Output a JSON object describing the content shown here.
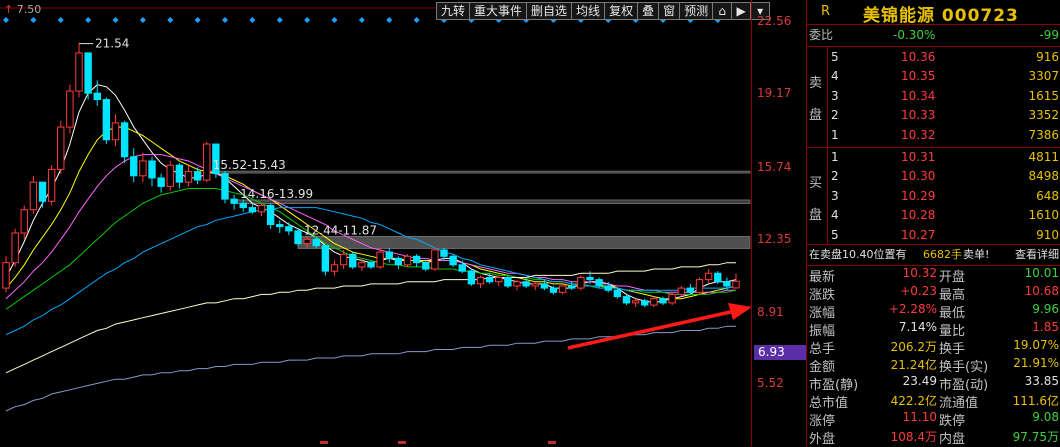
{
  "top_left_label": "7.50",
  "toolbar": [
    "九转",
    "重大事件",
    "删自选",
    "均线",
    "复权",
    "叠",
    "窗",
    "预测"
  ],
  "y_axis_ticks": [
    "22.56",
    "19.17",
    "15.74",
    "12.35",
    "8.91",
    "5.52"
  ],
  "y_axis_current": "6.93",
  "peak_label": "21.54",
  "gap_labels": [
    "15.52-15.43",
    "14.16-13.99",
    "12.44-11.87"
  ],
  "header": {
    "flag": "R",
    "title": "美锦能源 000723"
  },
  "weibi": {
    "label": "委比",
    "pct": "-0.30%",
    "diff": "-99"
  },
  "sell": {
    "label_chars": [
      "卖",
      "盘"
    ],
    "levels": [
      {
        "lvl": "5",
        "price": "10.36",
        "vol": "916"
      },
      {
        "lvl": "4",
        "price": "10.35",
        "vol": "3307"
      },
      {
        "lvl": "3",
        "price": "10.34",
        "vol": "1615"
      },
      {
        "lvl": "2",
        "price": "10.33",
        "vol": "3352"
      },
      {
        "lvl": "1",
        "price": "10.32",
        "vol": "7386"
      }
    ]
  },
  "buy": {
    "label_chars": [
      "买",
      "盘"
    ],
    "levels": [
      {
        "lvl": "1",
        "price": "10.31",
        "vol": "4811"
      },
      {
        "lvl": "2",
        "price": "10.30",
        "vol": "8498"
      },
      {
        "lvl": "3",
        "price": "10.29",
        "vol": "648"
      },
      {
        "lvl": "4",
        "price": "10.28",
        "vol": "1610"
      },
      {
        "lvl": "5",
        "price": "10.27",
        "vol": "910"
      }
    ]
  },
  "notice": {
    "prefix": "在卖盘10.40位置有",
    "qty": "6682手",
    "suffix": "卖单!",
    "link": "查看详细"
  },
  "stats": [
    {
      "l1": "最新",
      "v1": "10.32",
      "c1": "red",
      "l2": "开盘",
      "v2": "10.01",
      "c2": "green"
    },
    {
      "l1": "涨跌",
      "v1": "+0.23",
      "c1": "red",
      "l2": "最高",
      "v2": "10.68",
      "c2": "red"
    },
    {
      "l1": "涨幅",
      "v1": "+2.28%",
      "c1": "red",
      "l2": "最低",
      "v2": "9.96",
      "c2": "green"
    },
    {
      "l1": "振幅",
      "v1": "7.14%",
      "c1": "white",
      "l2": "量比",
      "v2": "1.85",
      "c2": "red"
    },
    {
      "l1": "总手",
      "v1": "206.2万",
      "c1": "yellow",
      "l2": "换手",
      "v2": "19.07%",
      "c2": "yellow"
    },
    {
      "l1": "金额",
      "v1": "21.24亿",
      "c1": "yellow",
      "l2": "换手(实)",
      "v2": "21.91%",
      "c2": "yellow"
    },
    {
      "l1": "市盈(静)",
      "v1": "23.49",
      "c1": "white",
      "l2": "市盈(动)",
      "v2": "33.85",
      "c2": "white"
    },
    {
      "l1": "总市值",
      "v1": "422.2亿",
      "c1": "yellow",
      "l2": "流通值",
      "v2": "111.6亿",
      "c2": "yellow"
    },
    {
      "l1": "涨停",
      "v1": "11.10",
      "c1": "red",
      "l2": "跌停",
      "v2": "9.08",
      "c2": "green"
    },
    {
      "l1": "外盘",
      "v1": "108.4万",
      "c1": "red",
      "l2": "内盘",
      "v2": "97.75万",
      "c2": "green"
    }
  ],
  "colors": {
    "up": "#ff3b3b",
    "down": "#00e5ff",
    "accent": "#e8c000",
    "grid": "#8b0000"
  },
  "chart_data": {
    "type": "candlestick",
    "y_range": [
      5.52,
      22.56
    ],
    "candles": [
      [
        10.0,
        11.5,
        9.8,
        11.2
      ],
      [
        11.2,
        12.8,
        11.0,
        12.6
      ],
      [
        12.6,
        13.9,
        12.3,
        13.7
      ],
      [
        13.7,
        15.3,
        13.5,
        15.0
      ],
      [
        15.0,
        14.6,
        13.8,
        14.1
      ],
      [
        14.1,
        15.8,
        13.9,
        15.6
      ],
      [
        15.6,
        17.9,
        15.4,
        17.6
      ],
      [
        17.6,
        19.6,
        17.3,
        19.3
      ],
      [
        19.3,
        21.54,
        19.0,
        21.1
      ],
      [
        21.1,
        20.6,
        18.9,
        19.2
      ],
      [
        19.2,
        19.8,
        18.6,
        18.9
      ],
      [
        18.9,
        19.0,
        16.8,
        17.0
      ],
      [
        17.0,
        18.2,
        16.7,
        17.8
      ],
      [
        17.8,
        17.9,
        15.9,
        16.2
      ],
      [
        16.2,
        16.6,
        15.0,
        15.3
      ],
      [
        15.3,
        16.4,
        15.0,
        16.0
      ],
      [
        16.0,
        16.2,
        14.8,
        15.2
      ],
      [
        15.2,
        15.4,
        14.5,
        14.8
      ],
      [
        14.8,
        16.0,
        14.6,
        15.8
      ],
      [
        15.8,
        15.9,
        14.7,
        15.0
      ],
      [
        15.0,
        15.8,
        14.8,
        15.5
      ],
      [
        15.5,
        15.7,
        14.9,
        15.1
      ],
      [
        15.1,
        16.9,
        15.0,
        16.8
      ],
      [
        16.8,
        16.4,
        15.2,
        15.4
      ],
      [
        15.4,
        15.52,
        14.0,
        14.2
      ],
      [
        14.2,
        14.4,
        13.7,
        14.0
      ],
      [
        14.0,
        14.16,
        13.6,
        13.8
      ],
      [
        13.8,
        14.0,
        13.5,
        13.6
      ],
      [
        13.6,
        14.0,
        13.4,
        13.9
      ],
      [
        13.9,
        13.99,
        12.8,
        13.0
      ],
      [
        13.0,
        13.2,
        12.6,
        12.9
      ],
      [
        12.9,
        13.1,
        12.5,
        12.7
      ],
      [
        12.7,
        12.8,
        12.0,
        12.1
      ],
      [
        12.1,
        12.44,
        11.9,
        12.3
      ],
      [
        12.3,
        12.4,
        11.87,
        12.0
      ],
      [
        12.0,
        11.9,
        10.6,
        10.8
      ],
      [
        10.8,
        11.3,
        10.6,
        11.1
      ],
      [
        11.1,
        11.8,
        10.9,
        11.6
      ],
      [
        11.6,
        11.7,
        10.9,
        11.0
      ],
      [
        11.0,
        11.4,
        10.8,
        11.2
      ],
      [
        11.2,
        11.3,
        10.9,
        11.0
      ],
      [
        11.0,
        11.9,
        10.9,
        11.7
      ],
      [
        11.7,
        11.9,
        11.2,
        11.4
      ],
      [
        11.4,
        11.5,
        10.9,
        11.1
      ],
      [
        11.1,
        11.6,
        11.0,
        11.5
      ],
      [
        11.5,
        11.6,
        11.0,
        11.2
      ],
      [
        11.2,
        11.3,
        10.8,
        10.9
      ],
      [
        10.9,
        11.9,
        10.8,
        11.8
      ],
      [
        11.8,
        11.9,
        11.3,
        11.5
      ],
      [
        11.5,
        11.6,
        11.0,
        11.1
      ],
      [
        11.1,
        11.3,
        10.7,
        10.8
      ],
      [
        10.8,
        10.9,
        10.1,
        10.2
      ],
      [
        10.2,
        10.6,
        10.0,
        10.5
      ],
      [
        10.5,
        10.7,
        10.2,
        10.3
      ],
      [
        10.3,
        10.6,
        10.1,
        10.5
      ],
      [
        10.5,
        10.6,
        10.0,
        10.1
      ],
      [
        10.1,
        10.4,
        9.9,
        10.3
      ],
      [
        10.3,
        10.5,
        10.0,
        10.1
      ],
      [
        10.1,
        10.3,
        9.9,
        10.2
      ],
      [
        10.2,
        10.4,
        9.9,
        10.0
      ],
      [
        10.0,
        10.1,
        9.7,
        9.8
      ],
      [
        9.8,
        10.2,
        9.7,
        10.1
      ],
      [
        10.1,
        10.3,
        9.9,
        10.0
      ],
      [
        10.0,
        10.6,
        9.9,
        10.5
      ],
      [
        10.5,
        10.8,
        10.2,
        10.4
      ],
      [
        10.4,
        10.5,
        10.0,
        10.1
      ],
      [
        10.1,
        10.3,
        9.8,
        9.9
      ],
      [
        9.9,
        10.0,
        9.5,
        9.6
      ],
      [
        9.6,
        9.7,
        9.2,
        9.3
      ],
      [
        9.3,
        9.5,
        9.1,
        9.4
      ],
      [
        9.4,
        9.5,
        9.1,
        9.2
      ],
      [
        9.2,
        9.6,
        9.1,
        9.5
      ],
      [
        9.5,
        9.6,
        9.2,
        9.3
      ],
      [
        9.3,
        9.8,
        9.2,
        9.7
      ],
      [
        9.7,
        10.1,
        9.6,
        10.0
      ],
      [
        10.0,
        10.2,
        9.7,
        9.8
      ],
      [
        9.8,
        10.5,
        9.7,
        10.4
      ],
      [
        10.4,
        10.9,
        10.2,
        10.7
      ],
      [
        10.7,
        10.8,
        10.2,
        10.3
      ],
      [
        10.3,
        10.5,
        9.9,
        10.1
      ],
      [
        10.01,
        10.68,
        9.96,
        10.32
      ]
    ],
    "moving_averages": [
      {
        "color": "#ffffff",
        "values": [
          10.5,
          11.3,
          12.2,
          13.2,
          14.0,
          14.7,
          15.6,
          16.8,
          18.3,
          19.2,
          19.6,
          19.5,
          19.1,
          18.4,
          17.6,
          17.0,
          16.4,
          15.9,
          15.6,
          15.4,
          15.2,
          15.2,
          15.4,
          15.5,
          15.2,
          14.8,
          14.4,
          14.0,
          13.8,
          13.6,
          13.3,
          13.0,
          12.8,
          12.6,
          12.4,
          12.0,
          11.7,
          11.5,
          11.4,
          11.3,
          11.2,
          11.3,
          11.4,
          11.3,
          11.3,
          11.3,
          11.2,
          11.3,
          11.4,
          11.4,
          11.2,
          10.9,
          10.7,
          10.6,
          10.5,
          10.4,
          10.3,
          10.2,
          10.2,
          10.2,
          10.0,
          10.0,
          10.0,
          10.2,
          10.3,
          10.3,
          10.2,
          10.0,
          9.7,
          9.5,
          9.4,
          9.3,
          9.4,
          9.5,
          9.6,
          9.7,
          10.0,
          10.2,
          10.3,
          10.3,
          10.4
        ]
      },
      {
        "color": "#ffff00",
        "values": [
          10.0,
          10.5,
          11.1,
          11.8,
          12.4,
          13.0,
          13.7,
          14.5,
          15.5,
          16.3,
          17.0,
          17.4,
          17.6,
          17.6,
          17.4,
          17.2,
          16.9,
          16.6,
          16.3,
          16.0,
          15.8,
          15.6,
          15.5,
          15.4,
          15.3,
          15.1,
          14.9,
          14.6,
          14.4,
          14.2,
          13.9,
          13.6,
          13.3,
          13.0,
          12.7,
          12.4,
          12.1,
          11.9,
          11.7,
          11.6,
          11.5,
          11.4,
          11.4,
          11.4,
          11.3,
          11.3,
          11.3,
          11.3,
          11.3,
          11.3,
          11.2,
          11.1,
          10.9,
          10.8,
          10.7,
          10.6,
          10.5,
          10.4,
          10.3,
          10.3,
          10.2,
          10.2,
          10.1,
          10.1,
          10.1,
          10.1,
          10.1,
          10.0,
          9.9,
          9.8,
          9.7,
          9.6,
          9.5,
          9.5,
          9.5,
          9.6,
          9.7,
          9.8,
          9.9,
          10.0,
          10.1
        ]
      },
      {
        "color": "#ff66ff",
        "values": [
          9.5,
          9.9,
          10.3,
          10.8,
          11.2,
          11.7,
          12.3,
          12.9,
          13.6,
          14.2,
          14.8,
          15.3,
          15.7,
          16.0,
          16.2,
          16.3,
          16.3,
          16.3,
          16.2,
          16.1,
          16.0,
          15.8,
          15.6,
          15.4,
          15.2,
          15.0,
          14.8,
          14.6,
          14.4,
          14.2,
          14.0,
          13.8,
          13.6,
          13.4,
          13.2,
          13.0,
          12.7,
          12.5,
          12.3,
          12.1,
          11.9,
          11.8,
          11.7,
          11.6,
          11.5,
          11.4,
          11.4,
          11.3,
          11.3,
          11.3,
          11.2,
          11.1,
          11.0,
          10.9,
          10.8,
          10.7,
          10.7,
          10.6,
          10.5,
          10.5,
          10.4,
          10.4,
          10.3,
          10.3,
          10.3,
          10.2,
          10.2,
          10.1,
          10.1,
          10.0,
          9.9,
          9.9,
          9.8,
          9.8,
          9.8,
          9.8,
          9.8,
          9.8,
          9.8,
          9.9,
          9.9
        ]
      },
      {
        "color": "#00cc00",
        "values": [
          9.0,
          9.3,
          9.6,
          9.9,
          10.2,
          10.5,
          10.8,
          11.1,
          11.5,
          11.9,
          12.3,
          12.7,
          13.1,
          13.4,
          13.7,
          14.0,
          14.2,
          14.4,
          14.5,
          14.6,
          14.7,
          14.7,
          14.7,
          14.7,
          14.6,
          14.5,
          14.4,
          14.2,
          14.0,
          13.8,
          13.6,
          13.3,
          13.0,
          12.7,
          12.4,
          12.1,
          11.9,
          11.7,
          11.5,
          11.4,
          11.3,
          11.2,
          11.1,
          11.1,
          11.0,
          11.0,
          11.0,
          10.9,
          10.9,
          10.9,
          10.8,
          10.8,
          10.7,
          10.7,
          10.6,
          10.6,
          10.5,
          10.5,
          10.4,
          10.4,
          10.3,
          10.3,
          10.2,
          10.2,
          10.1,
          10.1,
          10.0,
          10.0,
          9.9,
          9.9,
          9.8,
          9.8,
          9.8,
          9.7,
          9.7,
          9.7,
          9.7,
          9.7,
          9.8,
          9.8,
          9.9
        ]
      },
      {
        "color": "#00aaff",
        "values": [
          7.8,
          8.0,
          8.2,
          8.5,
          8.7,
          9.0,
          9.2,
          9.5,
          9.8,
          10.1,
          10.4,
          10.7,
          10.9,
          11.2,
          11.4,
          11.7,
          11.9,
          12.1,
          12.3,
          12.5,
          12.7,
          12.9,
          13.0,
          13.2,
          13.3,
          13.4,
          13.5,
          13.6,
          13.7,
          13.7,
          13.8,
          13.8,
          13.8,
          13.8,
          13.8,
          13.7,
          13.6,
          13.5,
          13.4,
          13.3,
          13.1,
          13.0,
          12.8,
          12.6,
          12.4,
          12.3,
          12.1,
          11.9,
          11.7,
          11.6,
          11.4,
          11.3,
          11.1,
          11.0,
          10.9,
          10.8,
          10.7,
          10.6,
          10.5,
          10.4,
          10.3,
          10.3,
          10.2,
          10.1,
          10.1,
          10.0,
          10.0,
          10.0,
          9.9,
          9.9,
          9.9,
          9.9,
          9.9,
          9.9,
          9.9,
          10.0,
          10.0,
          10.0,
          10.0,
          10.0,
          10.1
        ]
      },
      {
        "color": "#ffffcc",
        "values": [
          6.0,
          6.2,
          6.4,
          6.6,
          6.8,
          7.0,
          7.2,
          7.4,
          7.6,
          7.8,
          8.0,
          8.1,
          8.3,
          8.4,
          8.5,
          8.6,
          8.7,
          8.8,
          8.9,
          9.0,
          9.1,
          9.2,
          9.3,
          9.3,
          9.4,
          9.5,
          9.5,
          9.6,
          9.7,
          9.7,
          9.8,
          9.8,
          9.9,
          9.9,
          10.0,
          10.0,
          10.0,
          10.1,
          10.1,
          10.1,
          10.2,
          10.2,
          10.2,
          10.2,
          10.3,
          10.3,
          10.3,
          10.3,
          10.4,
          10.4,
          10.4,
          10.4,
          10.4,
          10.5,
          10.5,
          10.5,
          10.5,
          10.5,
          10.6,
          10.6,
          10.6,
          10.6,
          10.6,
          10.7,
          10.7,
          10.7,
          10.7,
          10.8,
          10.8,
          10.8,
          10.8,
          10.9,
          10.9,
          10.9,
          11.0,
          11.0,
          11.0,
          11.1,
          11.1,
          11.2,
          11.2
        ]
      },
      {
        "color": "#8899cc",
        "values": [
          4.2,
          4.4,
          4.5,
          4.7,
          4.8,
          5.0,
          5.1,
          5.2,
          5.3,
          5.4,
          5.5,
          5.6,
          5.7,
          5.7,
          5.8,
          5.9,
          5.9,
          6.0,
          6.0,
          6.1,
          6.1,
          6.2,
          6.2,
          6.3,
          6.3,
          6.4,
          6.4,
          6.4,
          6.5,
          6.5,
          6.5,
          6.6,
          6.6,
          6.6,
          6.7,
          6.7,
          6.7,
          6.8,
          6.8,
          6.8,
          6.9,
          6.9,
          6.9,
          6.9,
          7.0,
          7.0,
          7.0,
          7.1,
          7.1,
          7.1,
          7.2,
          7.2,
          7.2,
          7.3,
          7.3,
          7.3,
          7.4,
          7.4,
          7.4,
          7.5,
          7.5,
          7.5,
          7.6,
          7.6,
          7.6,
          7.7,
          7.7,
          7.7,
          7.8,
          7.8,
          7.8,
          7.9,
          7.9,
          7.9,
          8.0,
          8.0,
          8.0,
          8.1,
          8.1,
          8.2,
          8.2
        ]
      }
    ],
    "gap_bands": [
      [
        15.43,
        15.52
      ],
      [
        13.99,
        14.16
      ],
      [
        11.87,
        12.44
      ]
    ],
    "gap_start_index": [
      22,
      25,
      32
    ]
  }
}
